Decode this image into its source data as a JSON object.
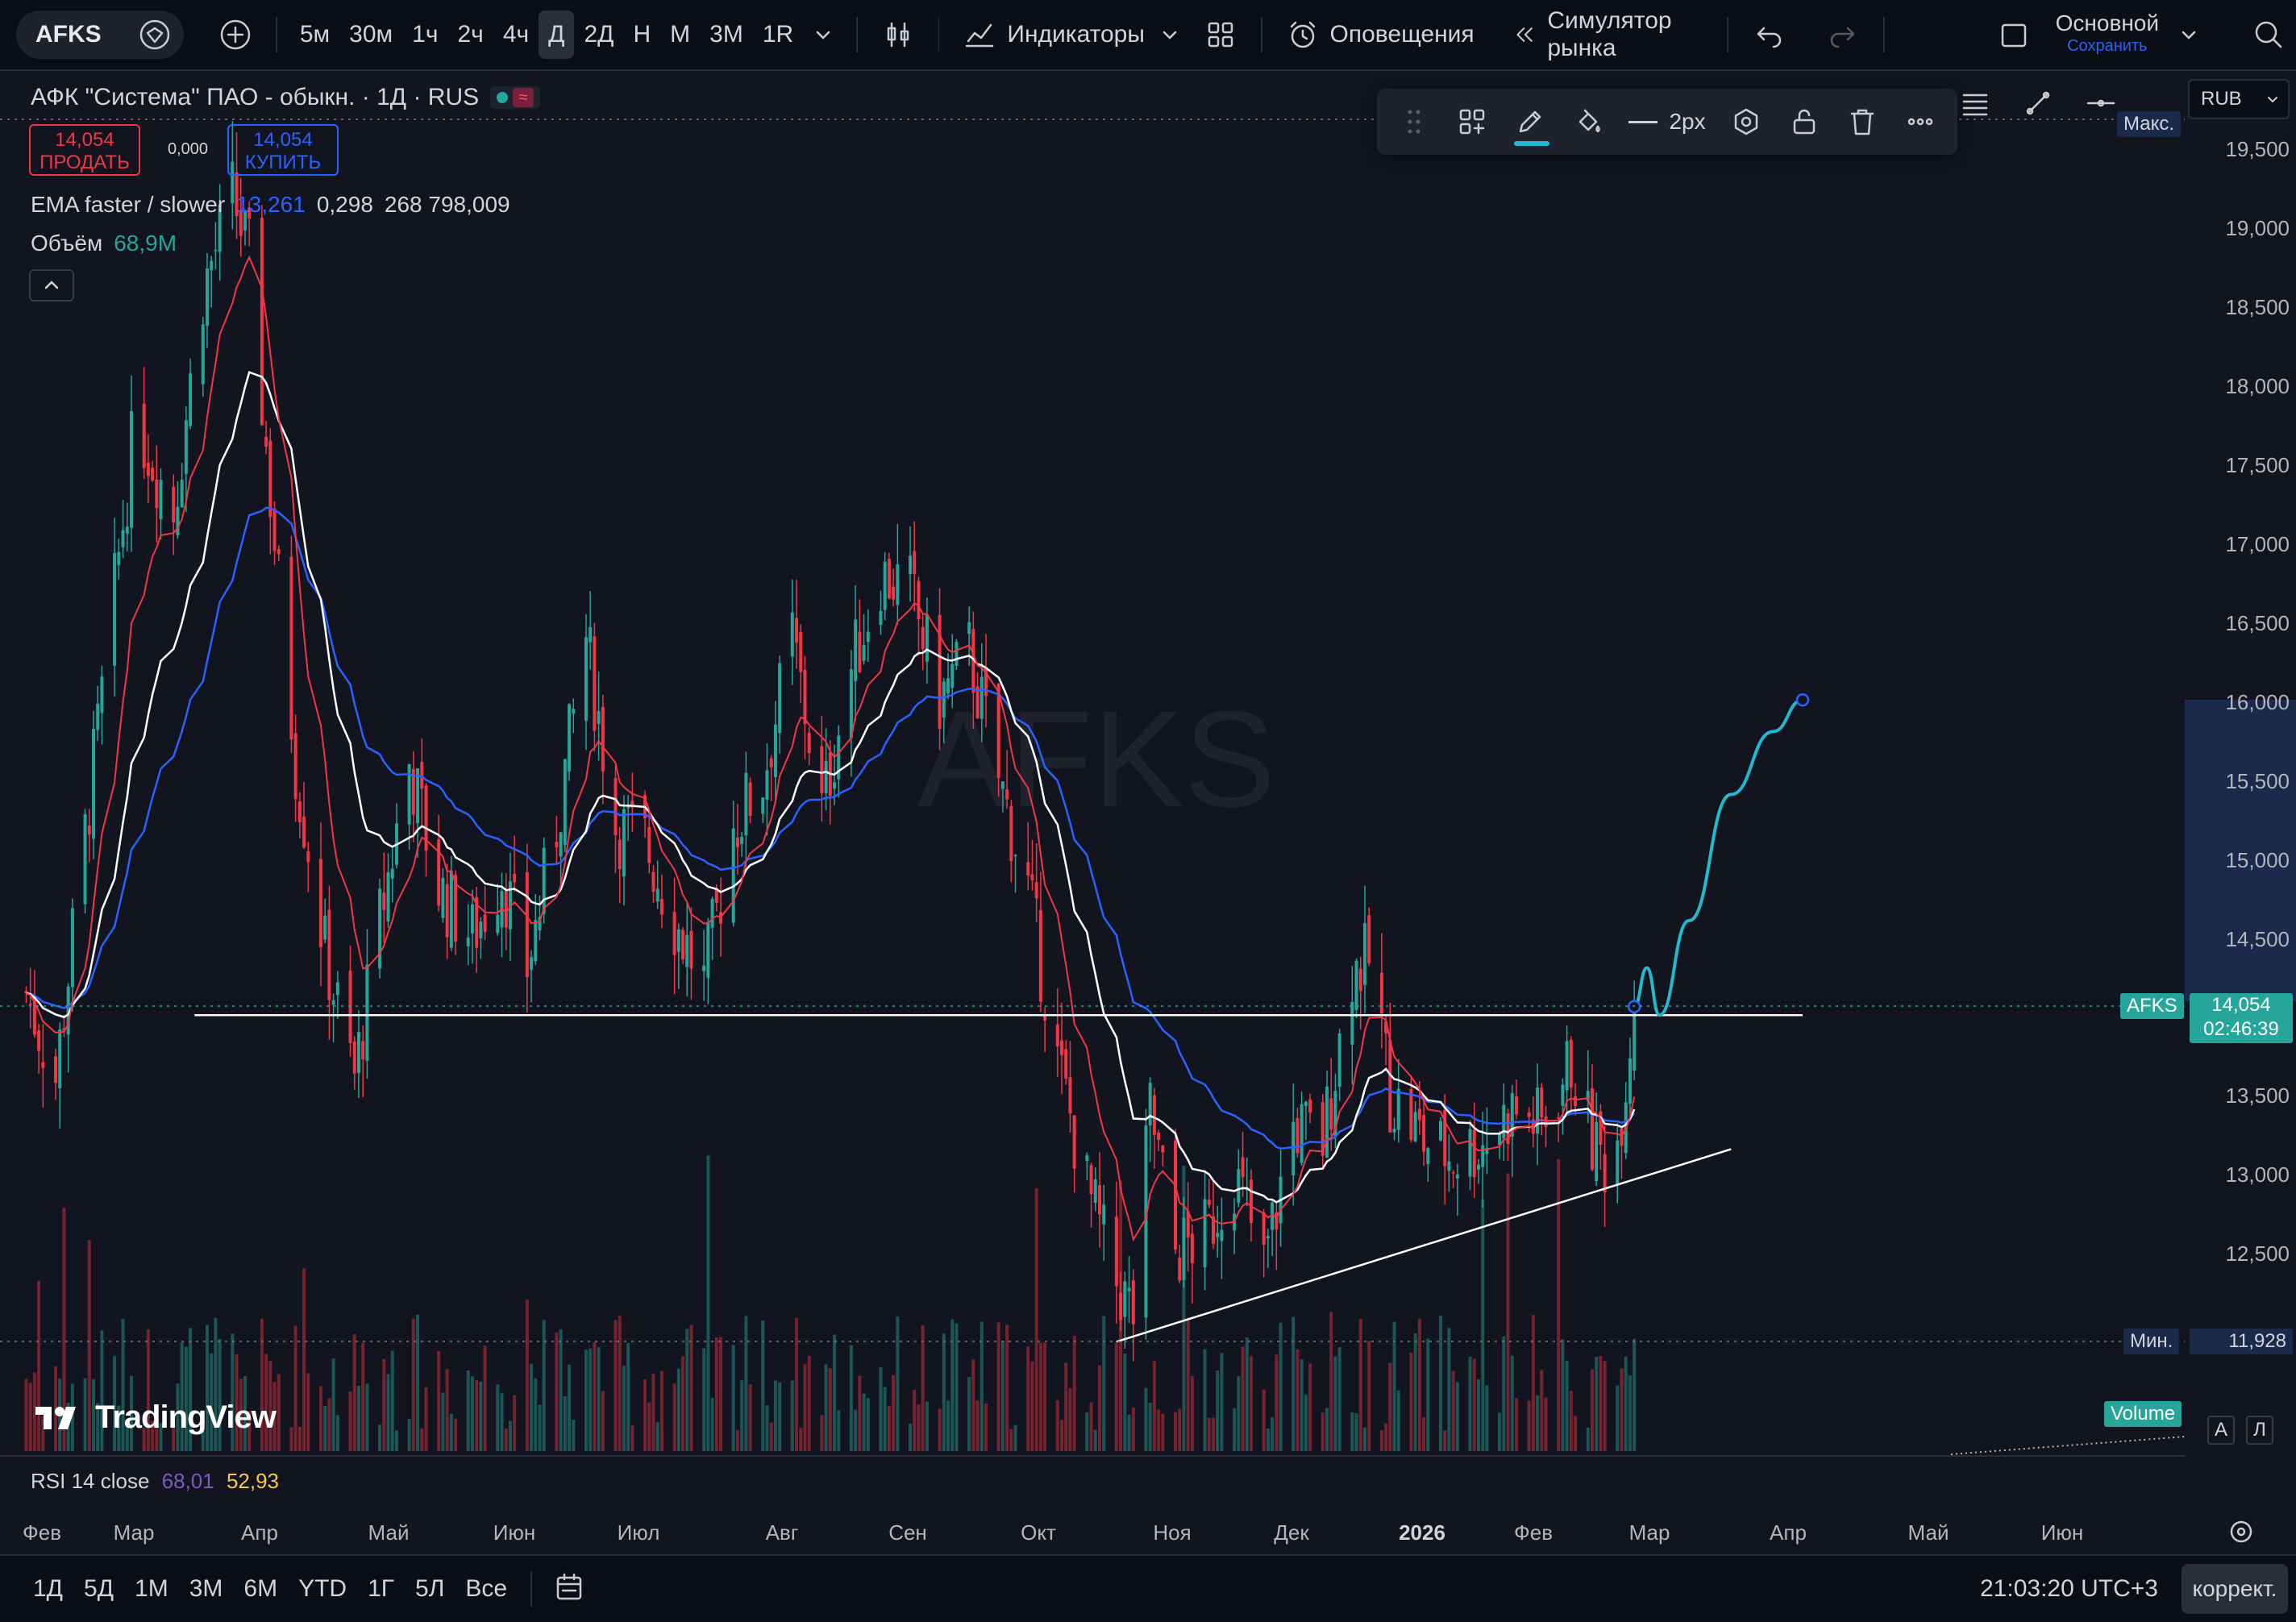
{
  "toolbar": {
    "symbol": "AFKS",
    "intervals": [
      "5м",
      "30м",
      "1ч",
      "2ч",
      "4ч",
      "Д",
      "2Д",
      "Н",
      "М",
      "3М",
      "1R"
    ],
    "active_interval": "Д",
    "indicators_label": "Индикаторы",
    "alerts_label": "Оповещения",
    "simulator_label": "Симулятор рынка",
    "layout_name": "Основной",
    "layout_save": "Сохранить"
  },
  "legend": {
    "title": "АФК \"Система\" ПАО - обыкн. · 1Д · RUS",
    "sell_price": "14,054",
    "sell_label": "ПРОДАТЬ",
    "spread": "0,000",
    "buy_price": "14,054",
    "buy_label": "КУПИТЬ",
    "ema_name": "EMA faster / slower",
    "ema_val1": "13,261",
    "ema_val2": "0,298",
    "ema_val3": "268 798,009",
    "volume_name": "Объём",
    "volume_val": "68,9M",
    "rsi_name": "RSI 14 close",
    "rsi_val1": "68,01",
    "rsi_val2": "52,93"
  },
  "drawing_toolbar": {
    "width_label": "2px"
  },
  "currency": "RUB",
  "watermark": "AFKS",
  "branding": "TradingView",
  "price_axis": {
    "max_tag": "Макс.",
    "labels": [
      "19,500",
      "19,000",
      "18,500",
      "18,000",
      "17,500",
      "17,000",
      "16,500",
      "16,000",
      "15,500",
      "15,000",
      "14,500",
      "13,500",
      "13,000",
      "12,500"
    ],
    "symbol_tag": "AFKS",
    "last_price": "14,054",
    "countdown": "02:46:39",
    "min_tag": "Мин.",
    "min_price": "11,928",
    "volume_tag": "Volume",
    "auto_btn": "A",
    "log_btn": "Л"
  },
  "time_axis": [
    "Фев",
    "Мар",
    "Апр",
    "Май",
    "Июн",
    "Июл",
    "Авг",
    "Сен",
    "Окт",
    "Ноя",
    "Дек",
    "2026",
    "Фев",
    "Мар",
    "Апр",
    "Май",
    "Июн"
  ],
  "bottom_bar": {
    "ranges": [
      "1Д",
      "5Д",
      "1М",
      "3М",
      "6М",
      "YTD",
      "1Г",
      "5Л",
      "Все"
    ],
    "clock": "21:03:20 UTC+3",
    "adjust_label": "коррект."
  },
  "colors": {
    "up": "#26a69a",
    "down": "#f23645",
    "ema_fast": "#f23645",
    "ema_slow": "#2962ff",
    "ma_white": "#ffffff",
    "forecast": "#22b8cf"
  },
  "chart_data": {
    "type": "candlestick",
    "symbol": "AFKS",
    "interval": "1D",
    "currency": "RUB",
    "x_range": [
      "2025-02",
      "2026-06"
    ],
    "y_range": [
      11500,
      19700
    ],
    "close_path": [
      {
        "date": "2025-02-01",
        "close": 14300
      },
      {
        "date": "2025-02-10",
        "close": 13600
      },
      {
        "date": "2025-02-20",
        "close": 15800
      },
      {
        "date": "2025-03-01",
        "close": 17800
      },
      {
        "date": "2025-03-10",
        "close": 17200
      },
      {
        "date": "2025-03-17",
        "close": 18600
      },
      {
        "date": "2025-03-24",
        "close": 19200
      },
      {
        "date": "2025-03-28",
        "close": 18800
      },
      {
        "date": "2025-04-03",
        "close": 17000
      },
      {
        "date": "2025-04-08",
        "close": 15600
      },
      {
        "date": "2025-04-15",
        "close": 14400
      },
      {
        "date": "2025-04-22",
        "close": 13600
      },
      {
        "date": "2025-04-28",
        "close": 14600
      },
      {
        "date": "2025-05-05",
        "close": 15600
      },
      {
        "date": "2025-05-12",
        "close": 14800
      },
      {
        "date": "2025-05-20",
        "close": 14500
      },
      {
        "date": "2025-05-27",
        "close": 14900
      },
      {
        "date": "2025-06-02",
        "close": 14300
      },
      {
        "date": "2025-06-09",
        "close": 15200
      },
      {
        "date": "2025-06-16",
        "close": 16400
      },
      {
        "date": "2025-06-23",
        "close": 15200
      },
      {
        "date": "2025-06-30",
        "close": 15100
      },
      {
        "date": "2025-07-07",
        "close": 14600
      },
      {
        "date": "2025-07-14",
        "close": 14200
      },
      {
        "date": "2025-07-21",
        "close": 15200
      },
      {
        "date": "2025-07-28",
        "close": 15500
      },
      {
        "date": "2025-08-04",
        "close": 16400
      },
      {
        "date": "2025-08-11",
        "close": 15300
      },
      {
        "date": "2025-08-18",
        "close": 16200
      },
      {
        "date": "2025-08-25",
        "close": 16800
      },
      {
        "date": "2025-09-01",
        "close": 16700
      },
      {
        "date": "2025-09-08",
        "close": 16000
      },
      {
        "date": "2025-09-15",
        "close": 16300
      },
      {
        "date": "2025-09-22",
        "close": 15500
      },
      {
        "date": "2025-09-29",
        "close": 14800
      },
      {
        "date": "2025-10-06",
        "close": 13700
      },
      {
        "date": "2025-10-13",
        "close": 12900
      },
      {
        "date": "2025-10-20",
        "close": 12300
      },
      {
        "date": "2025-10-24",
        "close": 12100
      },
      {
        "date": "2025-10-28",
        "close": 13400
      },
      {
        "date": "2025-11-03",
        "close": 12500
      },
      {
        "date": "2025-11-10",
        "close": 12600
      },
      {
        "date": "2025-11-17",
        "close": 13000
      },
      {
        "date": "2025-11-24",
        "close": 12400
      },
      {
        "date": "2025-12-01",
        "close": 13300
      },
      {
        "date": "2025-12-08",
        "close": 13200
      },
      {
        "date": "2025-12-15",
        "close": 14300
      },
      {
        "date": "2025-12-20",
        "close": 14350
      },
      {
        "date": "2025-12-24",
        "close": 13500
      },
      {
        "date": "2026-01-01",
        "close": 13200
      },
      {
        "date": "2026-01-08",
        "close": 13100
      },
      {
        "date": "2026-01-15",
        "close": 13200
      },
      {
        "date": "2026-01-22",
        "close": 13400
      },
      {
        "date": "2026-01-29",
        "close": 13300
      },
      {
        "date": "2026-02-05",
        "close": 13700
      },
      {
        "date": "2026-02-10",
        "close": 13200
      },
      {
        "date": "2026-02-15",
        "close": 13000
      },
      {
        "date": "2026-02-20",
        "close": 14054
      }
    ],
    "horizontal_line": {
      "price": 14000,
      "from": "2025-03-15",
      "to": "2026-04-01"
    },
    "trend_line": {
      "from": {
        "date": "2025-10-20",
        "price": 11928
      },
      "to": {
        "date": "2026-03-15",
        "price": 13150
      }
    },
    "forecast_curve": [
      {
        "date": "2026-02-20",
        "price": 14054
      },
      {
        "date": "2026-02-23",
        "price": 14300
      },
      {
        "date": "2026-02-26",
        "price": 14000
      },
      {
        "date": "2026-03-05",
        "price": 14600
      },
      {
        "date": "2026-03-15",
        "price": 15400
      },
      {
        "date": "2026-03-25",
        "price": 15800
      },
      {
        "date": "2026-04-01",
        "price": 16000
      }
    ],
    "last_price": 14054,
    "max_price": 19600,
    "min_price": 11928,
    "rsi": [
      68.01,
      52.93
    ]
  }
}
